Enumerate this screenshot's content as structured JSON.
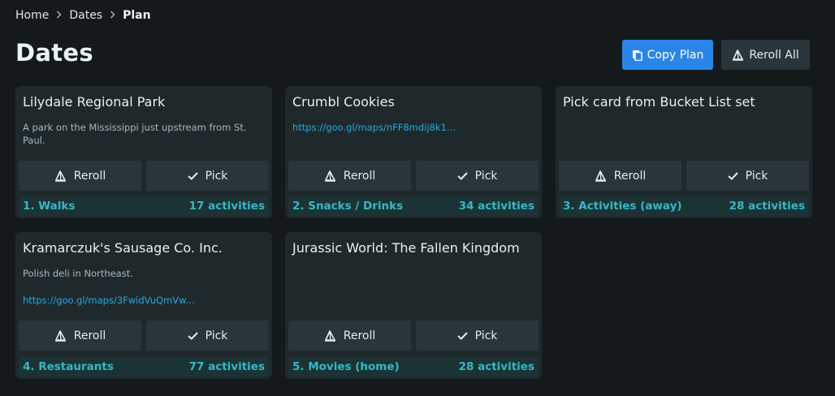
{
  "breadcrumb": {
    "home": "Home",
    "dates": "Dates",
    "current": "Plan"
  },
  "page": {
    "title": "Dates"
  },
  "toolbar": {
    "copy_label": "Copy Plan",
    "reroll_all_label": "Reroll All"
  },
  "buttons": {
    "reroll": "Reroll",
    "pick": "Pick"
  },
  "cards": [
    {
      "title": "Lilydale Regional Park",
      "description": "A park on the Mississippi just upstream from St. Paul.",
      "link": "",
      "category": "1. Walks",
      "count": "17 activities"
    },
    {
      "title": "Crumbl Cookies",
      "description": "",
      "link": "https://goo.gl/maps/nFF8mdij8k1...",
      "category": "2. Snacks / Drinks",
      "count": "34 activities"
    },
    {
      "title": "Pick card from Bucket List set",
      "description": "",
      "link": "",
      "category": "3. Activities (away)",
      "count": "28 activities"
    },
    {
      "title": "Kramarczuk's Sausage Co. Inc.",
      "description": "Polish deli in Northeast.",
      "link": "https://goo.gl/maps/3FwidVuQmVw...",
      "category": "4. Restaurants",
      "count": "77 activities"
    },
    {
      "title": "Jurassic World: The Fallen Kingdom",
      "description": "",
      "link": "",
      "category": "5. Movies (home)",
      "count": "28 activities"
    }
  ],
  "icons": {
    "breadcrumb_separator": "chevron-right-icon",
    "copy": "copy-icon",
    "reroll": "dice-icon",
    "pick": "check-icon"
  },
  "colors": {
    "accent": "#2a86e6",
    "footer_text": "#37b8c3",
    "link": "#2aa8e0"
  }
}
